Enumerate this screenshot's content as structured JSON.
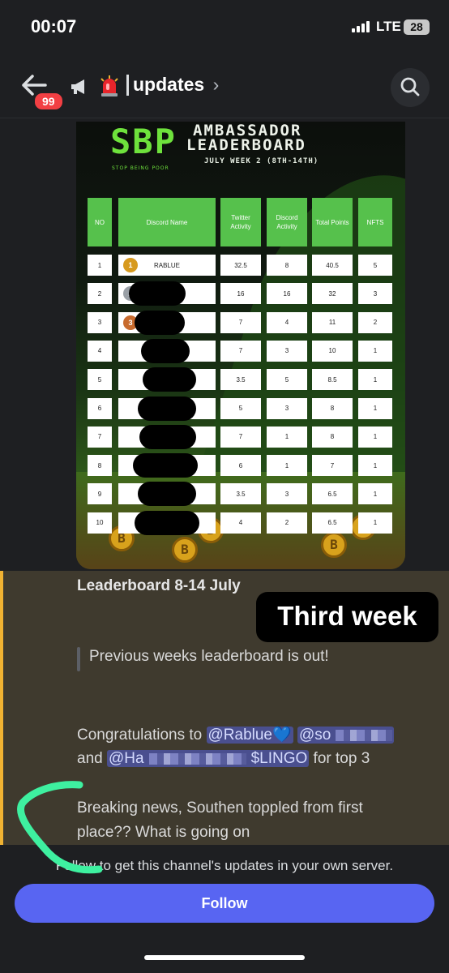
{
  "status_bar": {
    "time": "00:07",
    "network": "LTE",
    "battery": "28"
  },
  "header": {
    "unread_badge": "99",
    "channel_name": "updates",
    "chevron": "›",
    "icons": [
      "back-arrow-icon",
      "megaphone-icon",
      "siren-icon",
      "search-icon"
    ]
  },
  "poster": {
    "brand": "SBP",
    "brand_sub": "STOP BEING POOR",
    "title_line1": "AMBASSADOR",
    "title_line2": "LEADERBOARD",
    "week": "JULY WEEK 2 (8TH-14TH)",
    "columns": [
      "NO",
      "Discord Name",
      "Twitter Activity",
      "Discord Activity",
      "Total Points",
      "NFTS"
    ],
    "rows": [
      {
        "no": "1",
        "name": "RABLUE",
        "twitter": "32.5",
        "discord": "8",
        "total": "40.5",
        "nfts": "5"
      },
      {
        "no": "2",
        "name": "",
        "twitter": "16",
        "discord": "16",
        "total": "32",
        "nfts": "3"
      },
      {
        "no": "3",
        "name": "",
        "twitter": "7",
        "discord": "4",
        "total": "11",
        "nfts": "2"
      },
      {
        "no": "4",
        "name": "",
        "twitter": "7",
        "discord": "3",
        "total": "10",
        "nfts": "1"
      },
      {
        "no": "5",
        "name": "",
        "twitter": "3.5",
        "discord": "5",
        "total": "8.5",
        "nfts": "1"
      },
      {
        "no": "6",
        "name": "",
        "twitter": "5",
        "discord": "3",
        "total": "8",
        "nfts": "1"
      },
      {
        "no": "7",
        "name": "",
        "twitter": "7",
        "discord": "1",
        "total": "8",
        "nfts": "1"
      },
      {
        "no": "8",
        "name": "",
        "twitter": "6",
        "discord": "1",
        "total": "7",
        "nfts": "1"
      },
      {
        "no": "9",
        "name": "",
        "twitter": "3.5",
        "discord": "3",
        "total": "6.5",
        "nfts": "1"
      },
      {
        "no": "10",
        "name": "",
        "twitter": "4",
        "discord": "2",
        "total": "6.5",
        "nfts": "1"
      }
    ],
    "medals": [
      "1",
      "2",
      "3"
    ],
    "coin_letter": "B"
  },
  "message": {
    "title": "Leaderboard 8-14 July",
    "sticker": "Third week",
    "quote": "Previous weeks leaderboard is out!",
    "congrats_prefix": "Congratulations to ",
    "mention1": "@Rablue💙",
    "mention2": "@so",
    "and_word": "and ",
    "mention3_start": "@Ha",
    "mention3_end": "$LINGO",
    "congrats_suffix": " for top 3",
    "news_line1": "Breaking news, Southen toppled from first",
    "news_line2": "place?? What is going on"
  },
  "follow": {
    "text": "Follow to get this channel's updates in your own server.",
    "button": "Follow"
  },
  "colors": {
    "background": "#1e1f22",
    "accent": "#5865f2",
    "table_header": "#56c14c",
    "message_highlight": "#3f3a2e",
    "highlight_bar": "#f0b232",
    "scribble": "#3ef0a0"
  }
}
